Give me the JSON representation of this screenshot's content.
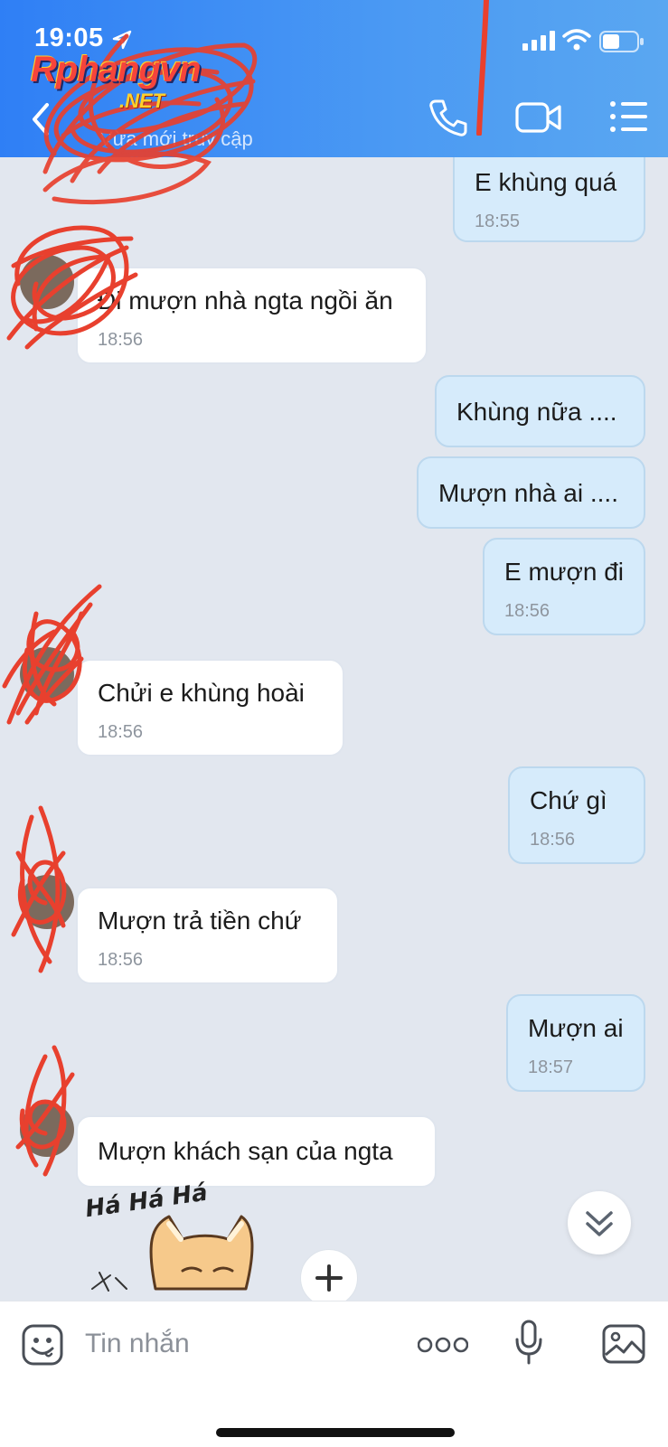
{
  "status_bar": {
    "time": "19:05"
  },
  "header": {
    "subtitle": "Vừa mới truy cập",
    "watermark_main": "Rphangvn",
    "watermark_sub": ".NET"
  },
  "messages": [
    {
      "dir": "out",
      "text": "E khùng quá",
      "time": "18:55"
    },
    {
      "dir": "in",
      "text": "Đi mượn nhà ngta ngồi ăn",
      "time": "18:56"
    },
    {
      "dir": "out",
      "text": "Khùng nữa ....",
      "time": ""
    },
    {
      "dir": "out",
      "text": "Mượn nhà ai ....",
      "time": ""
    },
    {
      "dir": "out",
      "text": "E mượn đi",
      "time": "18:56"
    },
    {
      "dir": "in",
      "text": "Chửi e khùng hoài",
      "time": "18:56"
    },
    {
      "dir": "out",
      "text": "Chứ gì",
      "time": "18:56"
    },
    {
      "dir": "in",
      "text": "Mượn trả tiền chứ",
      "time": "18:56"
    },
    {
      "dir": "out",
      "text": "Mượn ai",
      "time": "18:57"
    },
    {
      "dir": "in",
      "text": "Mượn khách sạn của ngta",
      "time": ""
    }
  ],
  "sticker": {
    "caption": "Há Há Há"
  },
  "input_bar": {
    "placeholder": "Tin nhắn"
  },
  "colors": {
    "header_blue": "#2f7ff5",
    "chat_bg": "#e2e7ef",
    "outgoing_bubble": "#d6ebfb",
    "incoming_bubble": "#ffffff",
    "scribble_red": "#e8402e"
  },
  "icons": [
    "location-arrow-icon",
    "signal-icon",
    "wifi-icon",
    "battery-icon",
    "back-icon",
    "phone-icon",
    "video-icon",
    "menu-icon",
    "chevron-double-down-icon",
    "emoji-icon",
    "more-icon",
    "microphone-icon",
    "image-icon"
  ]
}
